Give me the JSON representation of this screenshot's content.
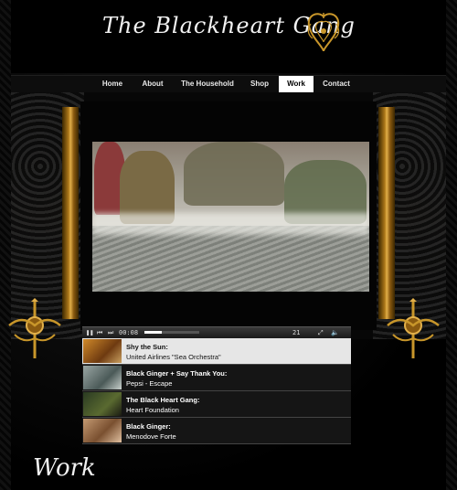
{
  "site": {
    "title": "The Blackheart Gang"
  },
  "nav": {
    "items": [
      {
        "label": "Home",
        "active": false
      },
      {
        "label": "About",
        "active": false
      },
      {
        "label": "The Household",
        "active": false
      },
      {
        "label": "Shop",
        "active": false
      },
      {
        "label": "Work",
        "active": true
      },
      {
        "label": "Contact",
        "active": false
      }
    ]
  },
  "player": {
    "time": "00:08",
    "volume": "21",
    "progress": 0.32,
    "icons": [
      "pause-icon",
      "prev-icon",
      "next-icon",
      "fullscreen-icon",
      "volume-icon"
    ]
  },
  "playlist": [
    {
      "title": "Shy the Sun:",
      "subtitle": "United Airlines \"Sea Orchestra\"",
      "selected": true
    },
    {
      "title": "Black Ginger + Say Thank You:",
      "subtitle": "Pepsi - Escape",
      "selected": false
    },
    {
      "title": "The Black Heart Gang:",
      "subtitle": "Heart Foundation",
      "selected": false
    },
    {
      "title": "Black Ginger:",
      "subtitle": "Menodove Forte",
      "selected": false
    }
  ],
  "section": {
    "title": "Work"
  },
  "colors": {
    "gold": "#c8962a",
    "nav_active_bg": "#ffffff",
    "selected_row_bg": "#e6e6e6"
  }
}
